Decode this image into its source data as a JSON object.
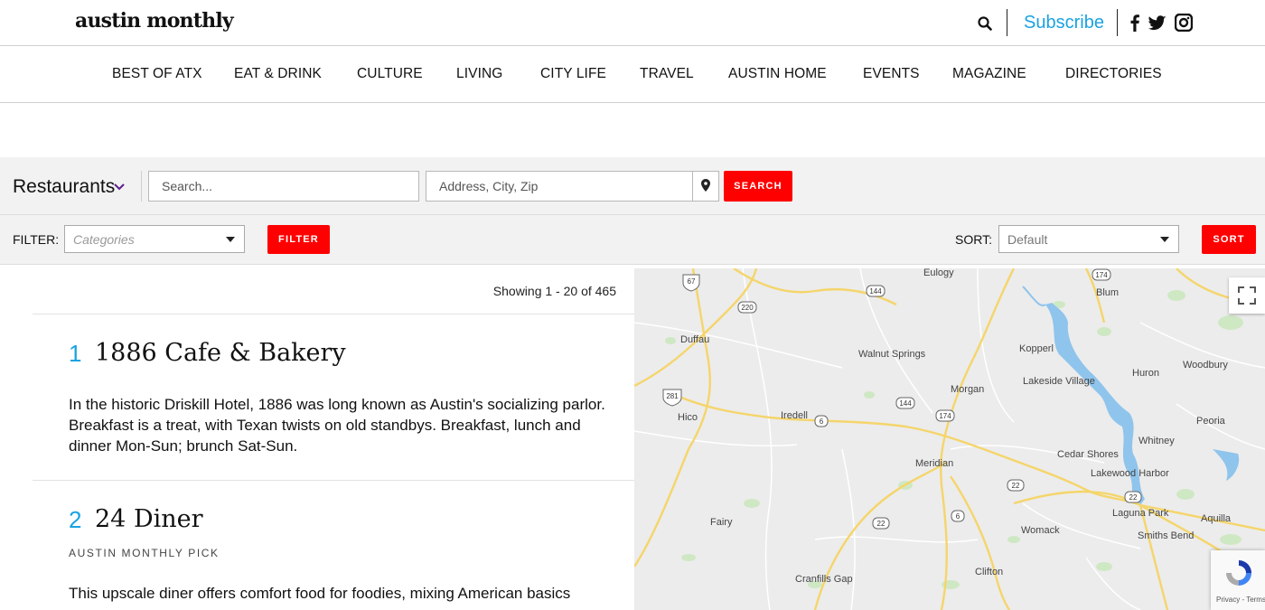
{
  "header": {
    "logo": "austin monthly",
    "subscribe": "Subscribe",
    "icons": [
      "search-icon",
      "facebook-icon",
      "twitter-icon",
      "instagram-icon"
    ]
  },
  "nav": {
    "items": [
      "BEST OF ATX",
      "EAT & DRINK",
      "CULTURE",
      "LIVING",
      "CITY LIFE",
      "TRAVEL",
      "AUSTIN HOME",
      "EVENTS",
      "MAGAZINE",
      "DIRECTORIES"
    ]
  },
  "search": {
    "category": "Restaurants",
    "keyword_placeholder": "Search...",
    "address_placeholder": "Address, City, Zip",
    "button": "SEARCH"
  },
  "filter": {
    "label": "FILTER:",
    "categories_placeholder": "Categories",
    "button": "FILTER",
    "sort_label": "SORT:",
    "sort_value": "Default",
    "sort_button": "SORT"
  },
  "results": {
    "showing": "Showing 1 - 20 of 465",
    "items": [
      {
        "num": "1",
        "title": "1886 Cafe & Bakery",
        "pick": "",
        "desc": "In the historic Driskill Hotel, 1886 was long known as Austin's socializing parlor. Breakfast is a treat, with Texan twists on old standbys. Breakfast, lunch and dinner Mon-Sun; brunch Sat-Sun."
      },
      {
        "num": "2",
        "title": "24 Diner",
        "pick": "AUSTIN MONTHLY PICK",
        "desc": "This upscale diner offers comfort food for foodies, mixing American basics"
      }
    ]
  },
  "map": {
    "towns": [
      "Eulogy",
      "Blum",
      "Duffau",
      "Walnut Springs",
      "Kopperl",
      "Huron",
      "Woodbury",
      "Lakeside Village",
      "Morgan",
      "Hico",
      "Iredell",
      "Peoria",
      "Whitney",
      "Cedar Shores",
      "Meridian",
      "Lakewood Harbor",
      "Fairy",
      "Womack",
      "Laguna Park",
      "Aquilla",
      "Smiths Bend",
      "Cranfills Gap",
      "Clifton"
    ],
    "routes": [
      "67",
      "220",
      "144",
      "174",
      "281",
      "144",
      "174",
      "6",
      "22",
      "6",
      "22",
      "22"
    ],
    "recaptcha_text": "Privacy - Terms"
  },
  "colors": {
    "accent_blue": "#1aa3e0",
    "button_red": "#ff0000",
    "bar_gray": "#f2f2f2"
  }
}
